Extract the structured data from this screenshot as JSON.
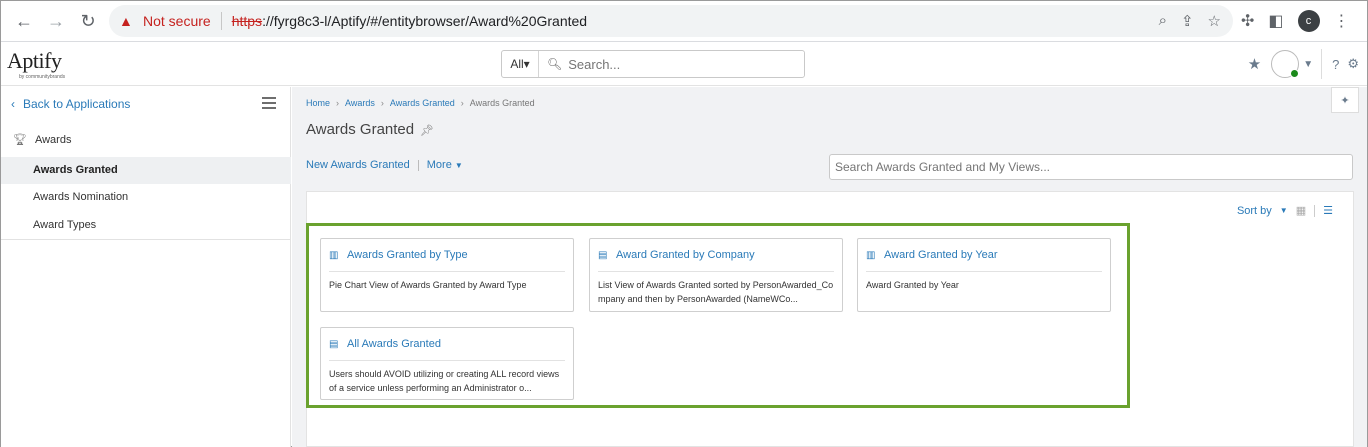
{
  "browser": {
    "not_secure": "Not secure",
    "url_https": "https",
    "url_rest": "://fyrg8c3-l/Aptify/#/entitybrowser/Award%20Granted",
    "profile_initial": "c"
  },
  "header": {
    "logo": "Aptify",
    "logo_sub": "by communitybrands",
    "search_scope": "All▾",
    "search_placeholder": "Search..."
  },
  "sidebar": {
    "back_label": "Back to Applications",
    "group_label": "Awards",
    "items": [
      {
        "label": "Awards Granted",
        "active": true
      },
      {
        "label": "Awards Nomination",
        "active": false
      },
      {
        "label": "Award Types",
        "active": false
      }
    ]
  },
  "main": {
    "breadcrumbs": [
      "Home",
      "Awards",
      "Awards Granted",
      "Awards Granted"
    ],
    "title": "Awards Granted",
    "new_label": "New Awards Granted",
    "more_label": "More",
    "view_search_placeholder": "Search Awards Granted and My Views...",
    "sort_label": "Sort by"
  },
  "cards": [
    {
      "title": "Awards Granted by Type",
      "icon": "bar-chart-icon",
      "description": "Pie Chart View of Awards Granted by Award Type"
    },
    {
      "title": "Award Granted by Company",
      "icon": "list-view-icon",
      "description": "List View of Awards Granted sorted by PersonAwarded_Company and then by PersonAwarded (NameWCo..."
    },
    {
      "title": "Award Granted by Year",
      "icon": "bar-chart-icon",
      "description": "Award Granted by Year"
    },
    {
      "title": "All Awards Granted",
      "icon": "list-view-icon",
      "description": "Users should AVOID utilizing or creating ALL record views of a service unless performing an Administrator o..."
    }
  ],
  "colors": {
    "link": "#2a7ab8",
    "highlight": "#6aa22e",
    "warning": "#c5221f"
  }
}
